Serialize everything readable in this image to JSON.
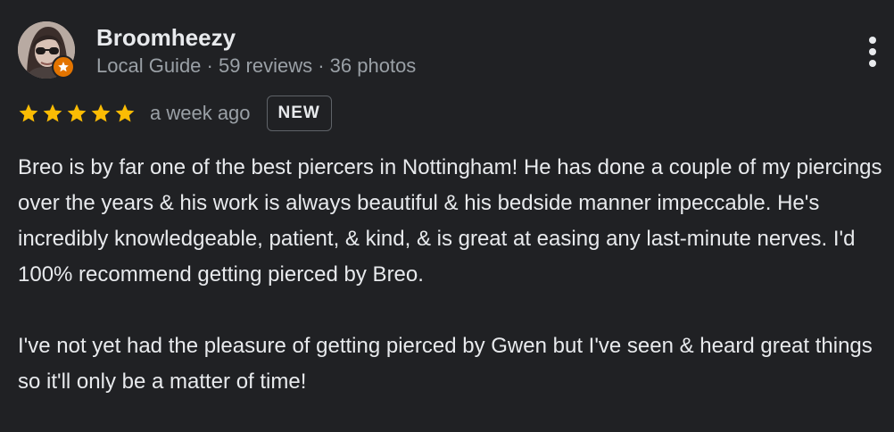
{
  "reviewer": {
    "name": "Broomheezy",
    "meta": "Local Guide · 59 reviews · 36 photos",
    "avatar_icon": "user-avatar-photo",
    "badge_icon": "local-guide-star-icon"
  },
  "rating": {
    "stars": 5,
    "max": 5,
    "star_color": "#fbbc04",
    "date": "a week ago",
    "badge": "NEW"
  },
  "review": {
    "paragraphs": [
      "Breo is by far one of the best piercers in Nottingham! He has done a couple of my piercings over the years & his work is always beautiful & his bedside manner impeccable. He's incredibly knowledgeable, patient, & kind, & is great at easing any last-minute nerves. I'd 100% recommend getting pierced by Breo.",
      "I've not yet had the pleasure of getting pierced by Gwen but I've seen & heard great things so it'll only be a matter of time!"
    ]
  },
  "menu": {
    "icon": "more-vert-icon"
  },
  "colors": {
    "background": "#202124",
    "text": "#e8eaed",
    "secondary_text": "#9aa0a6",
    "local_guide_badge": "#e37400"
  }
}
